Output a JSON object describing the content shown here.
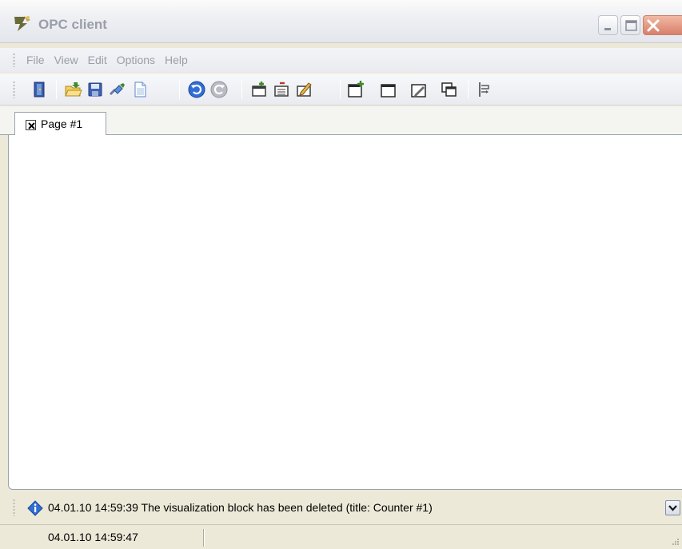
{
  "window": {
    "title": "OPC client",
    "controls": [
      "minimize",
      "maximize",
      "close"
    ]
  },
  "menu": {
    "items": [
      "File",
      "View",
      "Edit",
      "Options",
      "Help"
    ]
  },
  "toolbar": {
    "buttons": [
      "exit-icon",
      "open-folder-icon",
      "save-icon",
      "connect-icon",
      "new-document-icon",
      "undo-icon",
      "redo-icon",
      "add-page-icon",
      "add-page-list-icon",
      "edit-page-icon",
      "new-block-icon",
      "block-icon",
      "edit-block-icon",
      "copy-block-icon",
      "align-icon"
    ]
  },
  "tabs": [
    {
      "label": "Page #1",
      "active": true
    }
  ],
  "log": {
    "message": "04.01.10 14:59:39 The visualization block has been deleted (title: Counter #1)"
  },
  "status": {
    "time": "04.01.10 14:59:47"
  },
  "colors": {
    "accent_blue": "#2f6fd6",
    "toolbar_green": "#3d8a2a",
    "close_button": "#d77f6a"
  }
}
